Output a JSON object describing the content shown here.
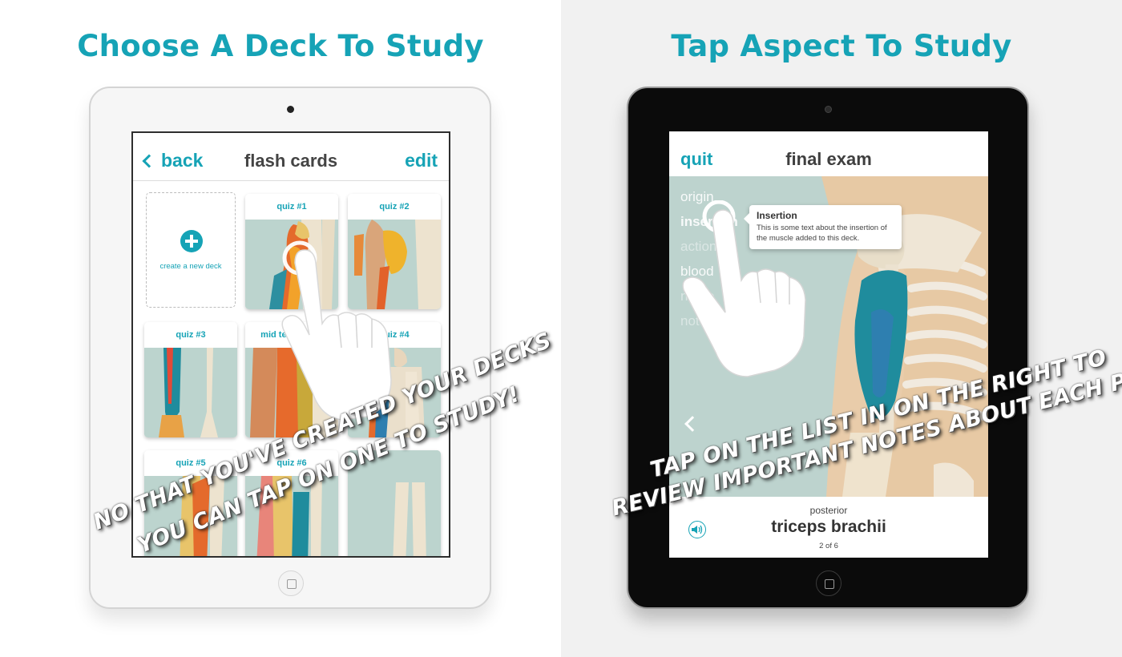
{
  "left_panel": {
    "headline": "Choose A Deck To Study",
    "nav": {
      "back_label": "back",
      "title": "flash cards",
      "edit_label": "edit"
    },
    "new_deck_label": "create a new deck",
    "cards": [
      {
        "title": "quiz #1"
      },
      {
        "title": "quiz #2"
      },
      {
        "title": "quiz #3"
      },
      {
        "title": "mid term exam"
      },
      {
        "title": "quiz #4"
      },
      {
        "title": "quiz #5"
      },
      {
        "title": "quiz #6"
      }
    ],
    "caption_line1": "NO THAT YOU'VE CREATED YOUR DECKS",
    "caption_line2": "YOU CAN TAP ON ONE TO STUDY!"
  },
  "right_panel": {
    "headline": "Tap Aspect To Study",
    "header": {
      "quit_label": "quit",
      "title": "final exam"
    },
    "aspects": [
      "origin",
      "insertion",
      "action",
      "blood",
      "nerve",
      "notes"
    ],
    "tooltip": {
      "title": "Insertion",
      "body": "This is some text about the insertion of the muscle added to this deck."
    },
    "footer": {
      "view": "posterior",
      "muscle": "triceps brachii",
      "count": "2 of 6"
    },
    "caption_line1": "TAP ON THE LIST IN ON THE RIGHT TO",
    "caption_line2": "REVIEW IMPORTANT NOTES ABOUT EACH PART"
  },
  "colors": {
    "accent": "#16a3b6",
    "muscle_bg": "#bcd4ce"
  },
  "icons": [
    "chevron-left-icon",
    "plus-icon",
    "speaker-icon",
    "tap-hand-icon"
  ]
}
